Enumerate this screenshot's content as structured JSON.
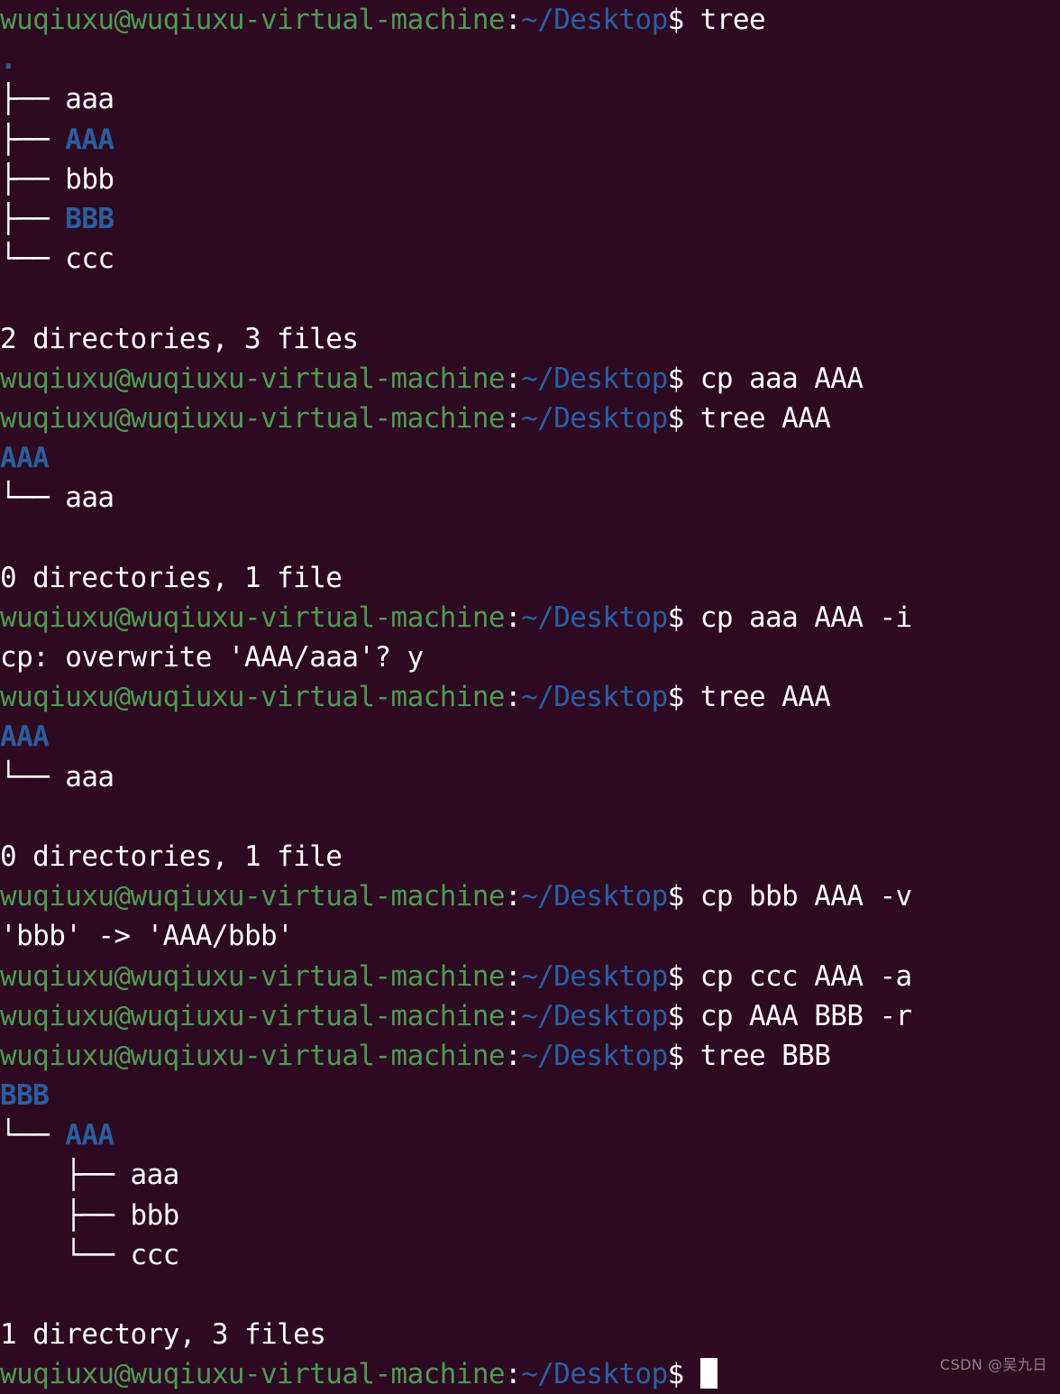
{
  "terminal": {
    "background_color": "#2d0a21",
    "prompt": {
      "user_host": "wuqiuxu@wuqiuxu-virtual-machine",
      "separator": ":",
      "path": "~/Desktop",
      "sigil": "$",
      "user_host_color": "#4e9a52",
      "path_color": "#2a5fa5",
      "text_color": "#ffffff"
    },
    "colors": {
      "directory": "#2b5d9e",
      "file": "#ffffff",
      "tree_branch": "#ffffff"
    },
    "cursor": {
      "shape": "block",
      "color": "#ffffff"
    },
    "lines": [
      {
        "type": "prompt",
        "command": "tree"
      },
      {
        "type": "output",
        "segments": [
          {
            "text": ".",
            "style": "dir"
          }
        ]
      },
      {
        "type": "output",
        "segments": [
          {
            "text": "├── ",
            "style": "tree"
          },
          {
            "text": "aaa",
            "style": "file"
          }
        ]
      },
      {
        "type": "output",
        "segments": [
          {
            "text": "├── ",
            "style": "tree"
          },
          {
            "text": "AAA",
            "style": "dir"
          }
        ]
      },
      {
        "type": "output",
        "segments": [
          {
            "text": "├── ",
            "style": "tree"
          },
          {
            "text": "bbb",
            "style": "file"
          }
        ]
      },
      {
        "type": "output",
        "segments": [
          {
            "text": "├── ",
            "style": "tree"
          },
          {
            "text": "BBB",
            "style": "dir"
          }
        ]
      },
      {
        "type": "output",
        "segments": [
          {
            "text": "└── ",
            "style": "tree"
          },
          {
            "text": "ccc",
            "style": "file"
          }
        ]
      },
      {
        "type": "output",
        "segments": []
      },
      {
        "type": "output",
        "segments": [
          {
            "text": "2 directories, 3 files",
            "style": "file"
          }
        ]
      },
      {
        "type": "prompt",
        "command": "cp aaa AAA"
      },
      {
        "type": "prompt",
        "command": "tree AAA"
      },
      {
        "type": "output",
        "segments": [
          {
            "text": "AAA",
            "style": "dir"
          }
        ]
      },
      {
        "type": "output",
        "segments": [
          {
            "text": "└── ",
            "style": "tree"
          },
          {
            "text": "aaa",
            "style": "file"
          }
        ]
      },
      {
        "type": "output",
        "segments": []
      },
      {
        "type": "output",
        "segments": [
          {
            "text": "0 directories, 1 file",
            "style": "file"
          }
        ]
      },
      {
        "type": "prompt",
        "command": "cp aaa AAA -i"
      },
      {
        "type": "output",
        "segments": [
          {
            "text": "cp: overwrite 'AAA/aaa'? y",
            "style": "file"
          }
        ]
      },
      {
        "type": "prompt",
        "command": "tree AAA"
      },
      {
        "type": "output",
        "segments": [
          {
            "text": "AAA",
            "style": "dir"
          }
        ]
      },
      {
        "type": "output",
        "segments": [
          {
            "text": "└── ",
            "style": "tree"
          },
          {
            "text": "aaa",
            "style": "file"
          }
        ]
      },
      {
        "type": "output",
        "segments": []
      },
      {
        "type": "output",
        "segments": [
          {
            "text": "0 directories, 1 file",
            "style": "file"
          }
        ]
      },
      {
        "type": "prompt",
        "command": "cp bbb AAA -v"
      },
      {
        "type": "output",
        "segments": [
          {
            "text": "'bbb' -> 'AAA/bbb'",
            "style": "file"
          }
        ]
      },
      {
        "type": "prompt",
        "command": "cp ccc AAA -a"
      },
      {
        "type": "prompt",
        "command": "cp AAA BBB -r"
      },
      {
        "type": "prompt",
        "command": "tree BBB"
      },
      {
        "type": "output",
        "segments": [
          {
            "text": "BBB",
            "style": "dir"
          }
        ]
      },
      {
        "type": "output",
        "segments": [
          {
            "text": "└── ",
            "style": "tree"
          },
          {
            "text": "AAA",
            "style": "dir"
          }
        ]
      },
      {
        "type": "output",
        "segments": [
          {
            "text": "    ├── ",
            "style": "tree"
          },
          {
            "text": "aaa",
            "style": "file"
          }
        ]
      },
      {
        "type": "output",
        "segments": [
          {
            "text": "    ├── ",
            "style": "tree"
          },
          {
            "text": "bbb",
            "style": "file"
          }
        ]
      },
      {
        "type": "output",
        "segments": [
          {
            "text": "    └── ",
            "style": "tree"
          },
          {
            "text": "ccc",
            "style": "file"
          }
        ]
      },
      {
        "type": "output",
        "segments": []
      },
      {
        "type": "output",
        "segments": [
          {
            "text": "1 directory, 3 files",
            "style": "file"
          }
        ]
      },
      {
        "type": "prompt",
        "command": "",
        "cursor": true
      }
    ]
  },
  "watermark": {
    "text": "CSDN @吴九日"
  }
}
